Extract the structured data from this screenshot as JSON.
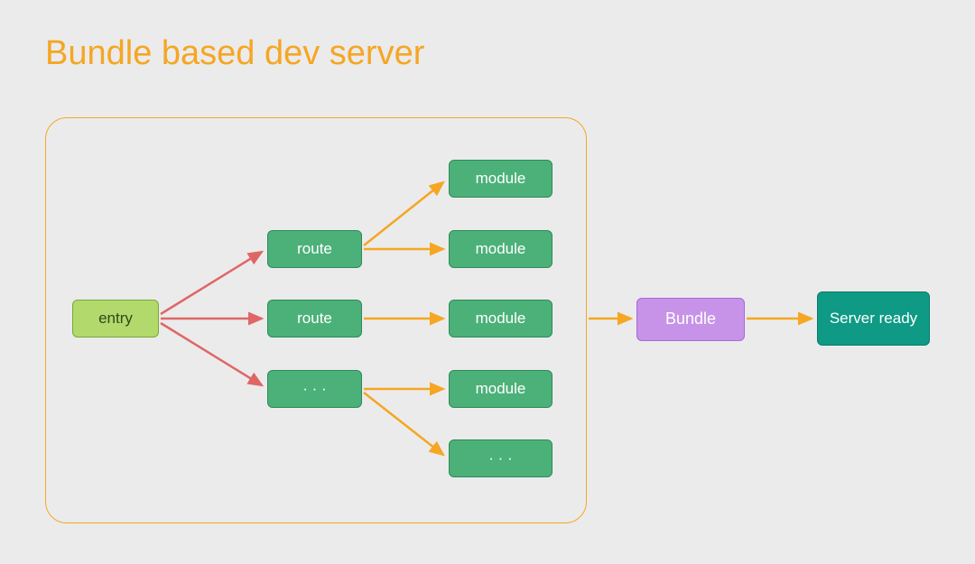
{
  "title": "Bundle based dev server",
  "nodes": {
    "entry": "entry",
    "route1": "route",
    "route2": "route",
    "route3": "· · ·",
    "module1": "module",
    "module2": "module",
    "module3": "module",
    "module4": "module",
    "module5": "· · ·",
    "bundle": "Bundle",
    "server": "Server ready"
  },
  "colors": {
    "title": "#f5a623",
    "border": "#f5a623",
    "entry_bg": "#b2d96b",
    "route_bg": "#4cb179",
    "bundle_bg": "#c793e8",
    "server_bg": "#0e9a84",
    "arrow_red": "#e06666",
    "arrow_orange": "#f5a623"
  }
}
